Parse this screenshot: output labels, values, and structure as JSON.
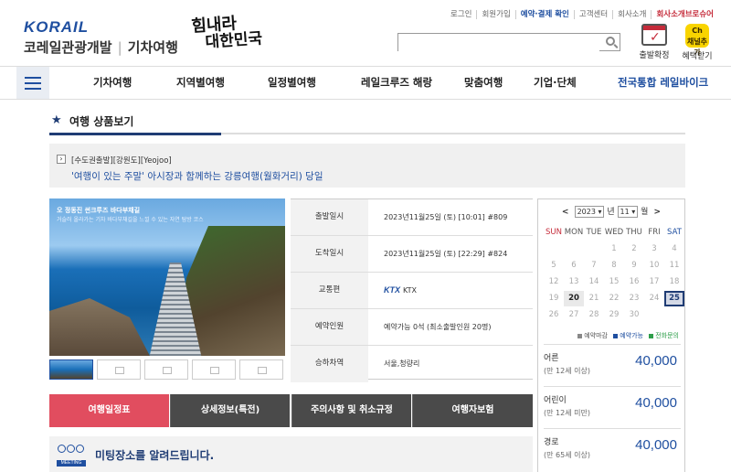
{
  "header": {
    "logo_en": "KORAIL",
    "logo_ko": "코레일관광개발",
    "logo_sub": "기차여행",
    "calligraphy_line1": "힘내라",
    "calligraphy_line2": "대한민국",
    "top_links": [
      "로그인",
      "회원가입",
      "예약·결제 확인",
      "고객센터",
      "회사소개",
      "회사소개브로슈어"
    ],
    "search_placeholder": "",
    "quick1_label": "출발확정",
    "quick2_badge": "Ch\n채널추가",
    "quick2_label": "혜택받기"
  },
  "nav": {
    "items": [
      "기차여행",
      "지역별여행",
      "일정별여행",
      "레일크루즈 해랑",
      "맞춤여행",
      "기업·단체",
      "전국통합 레일바이크"
    ]
  },
  "section": {
    "title": "여행 상품보기"
  },
  "product": {
    "tags": "[수도권출발][강원도][Yeojoo]",
    "name": "'여행이 있는 주말' 아시장과 함께하는 강릉여행(월화거리) 당일",
    "photo_caption": "오 정동진 썬크루즈 바다부채길",
    "photo_subcaption": "거슬러 올라가는 기차 바다부채길을 느낄 수 있는 자연 탐방 코스"
  },
  "info": [
    {
      "label": "출발일시",
      "value": "2023년11월25일 (토) [10:01] #809"
    },
    {
      "label": "도착일시",
      "value": "2023년11월25일 (토) [22:29] #824"
    },
    {
      "label": "교통편",
      "value": "KTX"
    },
    {
      "label": "예약인원",
      "value": "예약가능 0석 (최소출발인원 20명)"
    },
    {
      "label": "승하차역",
      "value": "서울,청량리"
    }
  ],
  "calendar": {
    "year": "2023",
    "year_suffix": "년",
    "month": "11",
    "month_suffix": "월",
    "prev": "<",
    "next": ">",
    "weekdays": [
      "SUN",
      "MON",
      "TUE",
      "WED",
      "THU",
      "FRI",
      "SAT"
    ],
    "legend": [
      "예약마감",
      "예약가능",
      "전화문의"
    ],
    "legend_colors": [
      "#888888",
      "#1f4fa0",
      "#2e9e4a"
    ]
  },
  "prices": [
    {
      "label": "어른",
      "sub": "(만 12세 이상)",
      "value": "40,000"
    },
    {
      "label": "어린이",
      "sub": "(만 12세 미만)",
      "value": "40,000"
    },
    {
      "label": "경로",
      "sub": "(만 65세 이상)",
      "value": "40,000"
    }
  ],
  "tabs": [
    "여행일정표",
    "상세정보(특전)",
    "주의사항 및 취소규정",
    "여행자보험"
  ],
  "meeting": {
    "icon_label": "MEETING",
    "text": "미팅장소를 알려드립니다."
  }
}
